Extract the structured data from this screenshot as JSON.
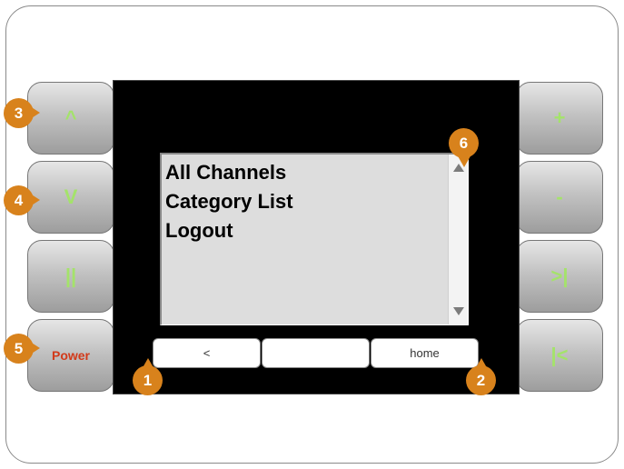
{
  "left_buttons": [
    {
      "label": "^"
    },
    {
      "label": "V"
    },
    {
      "label": "||"
    },
    {
      "label": "Power"
    }
  ],
  "right_buttons": [
    {
      "label": "+"
    },
    {
      "label": "-"
    },
    {
      "label": ">|"
    },
    {
      "label": "|<"
    }
  ],
  "list": {
    "items": [
      "All Channels",
      "Category List",
      "Logout"
    ]
  },
  "softkeys": {
    "left": "<",
    "middle": "",
    "right": "home"
  },
  "markers": [
    "1",
    "2",
    "3",
    "4",
    "5",
    "6"
  ],
  "colors": {
    "marker": "#d8821c",
    "button_label": "#a4e36a",
    "power_label": "#d23a1a",
    "screen": "#000000",
    "list_bg": "#dddddd"
  }
}
